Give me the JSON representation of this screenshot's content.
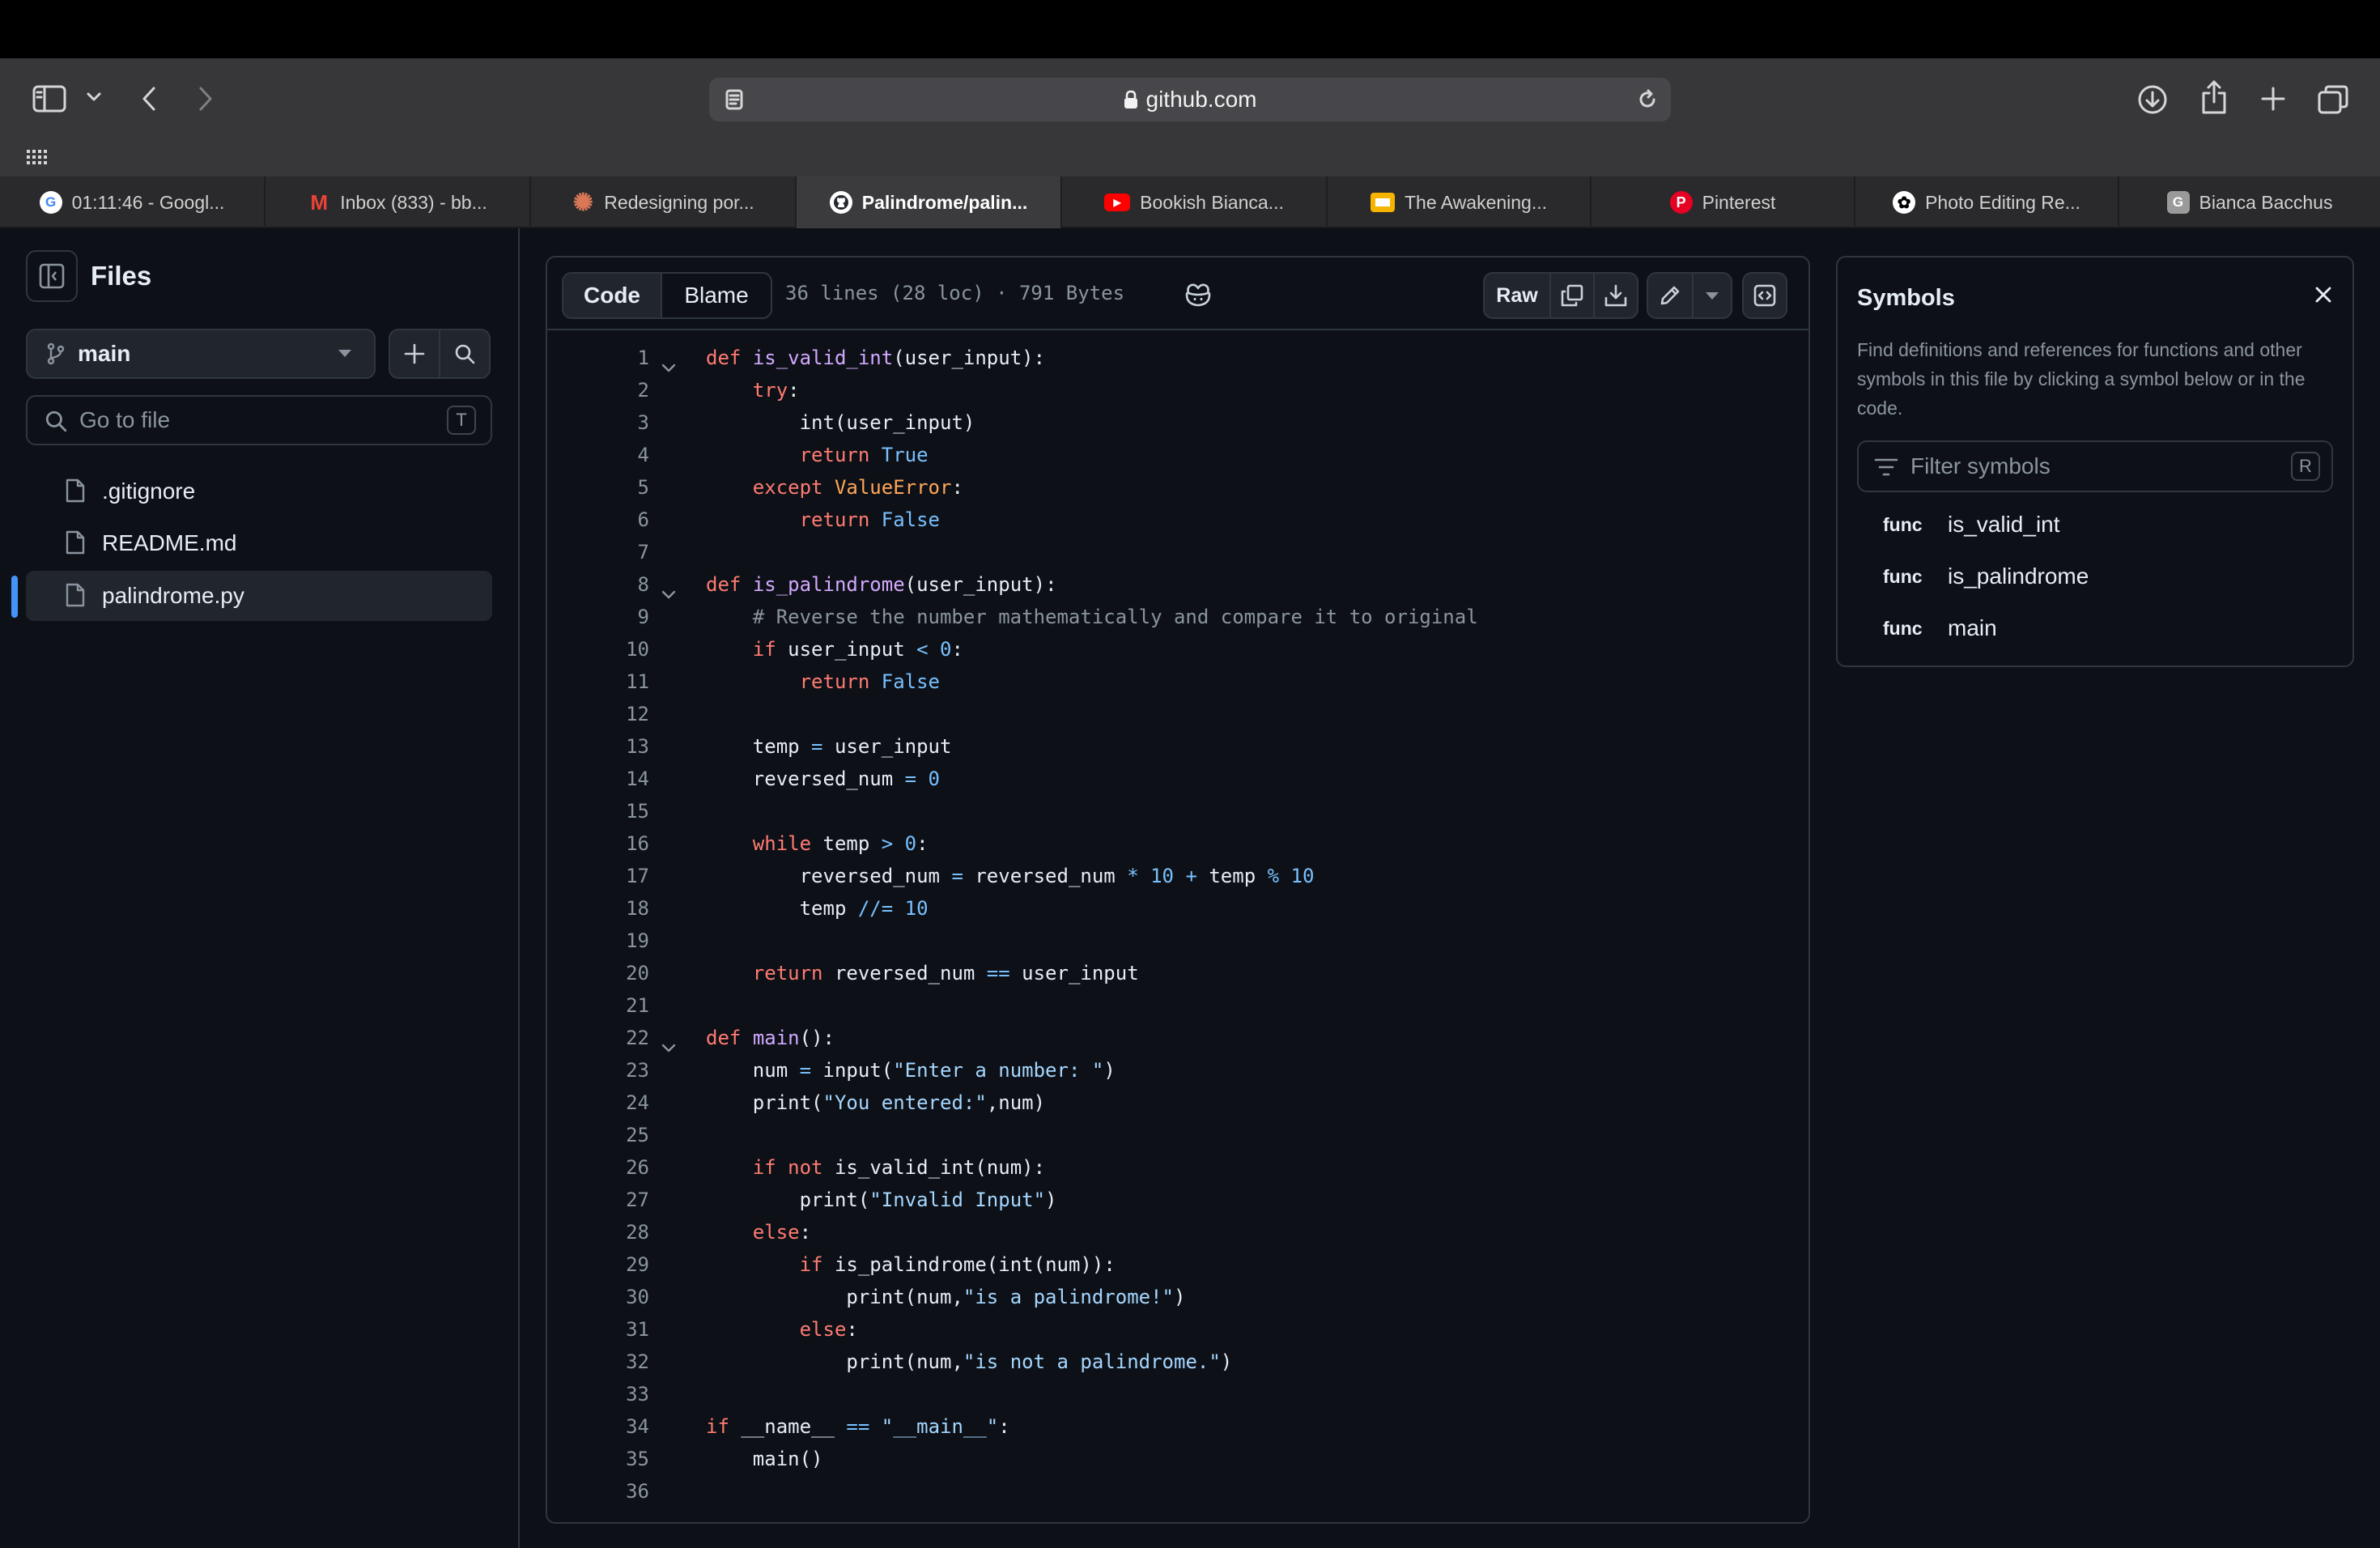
{
  "browser": {
    "address": "github.com",
    "tabs": [
      {
        "title": "01:11:46 - Googl...",
        "icon": "google-icon",
        "color": "#ffffff"
      },
      {
        "title": "Inbox (833) - bb...",
        "icon": "gmail-icon",
        "color": "#ea4335"
      },
      {
        "title": "Redesigning por...",
        "icon": "claude-icon",
        "color": "#d97757"
      },
      {
        "title": "Palindrome/palin...",
        "icon": "github-icon",
        "color": "#ffffff"
      },
      {
        "title": "Bookish Bianca...",
        "icon": "youtube-icon",
        "color": "#ff0000"
      },
      {
        "title": "The Awakening...",
        "icon": "slides-icon",
        "color": "#f4b400"
      },
      {
        "title": "Pinterest",
        "icon": "pinterest-icon",
        "color": "#e60023"
      },
      {
        "title": "Photo Editing Re...",
        "icon": "openai-icon",
        "color": "#ffffff"
      },
      {
        "title": "Bianca Bacchus",
        "icon": "g-icon",
        "color": "#9a9a9a"
      }
    ],
    "active_tab_index": 3
  },
  "sidebar": {
    "title": "Files",
    "branch": "main",
    "goto_placeholder": "Go to file",
    "goto_shortcut": "T",
    "files": [
      ".gitignore",
      "README.md",
      "palindrome.py"
    ],
    "selected_file": "palindrome.py"
  },
  "file_header": {
    "tab_code": "Code",
    "tab_blame": "Blame",
    "info": "36 lines (28 loc) · 791 Bytes",
    "raw_label": "Raw"
  },
  "code": {
    "language": "python",
    "fold_lines": [
      1,
      8,
      22
    ],
    "lines": [
      "def is_valid_int(user_input):",
      "    try:",
      "        int(user_input)",
      "        return True",
      "    except ValueError:",
      "        return False",
      "",
      "def is_palindrome(user_input):",
      "    # Reverse the number mathematically and compare it to original",
      "    if user_input < 0:",
      "        return False",
      "",
      "    temp = user_input",
      "    reversed_num = 0",
      "",
      "    while temp > 0:",
      "        reversed_num = reversed_num * 10 + temp % 10",
      "        temp //= 10",
      "",
      "    return reversed_num == user_input",
      "",
      "def main():",
      "    num = input(\"Enter a number: \")",
      "    print(\"You entered:\",num)",
      "",
      "    if not is_valid_int(num):",
      "        print(\"Invalid Input\")",
      "    else:",
      "        if is_palindrome(int(num)):",
      "            print(num,\"is a palindrome!\")",
      "        else:",
      "            print(num,\"is not a palindrome.\")",
      "",
      "if __name__ == \"__main__\":",
      "    main()",
      ""
    ]
  },
  "symbols": {
    "title": "Symbols",
    "description": "Find definitions and references for functions and other symbols in this file by clicking a symbol below or in the code.",
    "filter_placeholder": "Filter symbols",
    "filter_shortcut": "R",
    "items": [
      {
        "kind": "func",
        "name": "is_valid_int"
      },
      {
        "kind": "func",
        "name": "is_palindrome"
      },
      {
        "kind": "func",
        "name": "main"
      }
    ]
  },
  "colors": {
    "keyword": "#ff7b72",
    "function": "#d2a8ff",
    "constant": "#79c0ff",
    "string": "#a5d6ff",
    "comment": "#8b949e",
    "class": "#ffa657",
    "accent": "#4493f8"
  }
}
